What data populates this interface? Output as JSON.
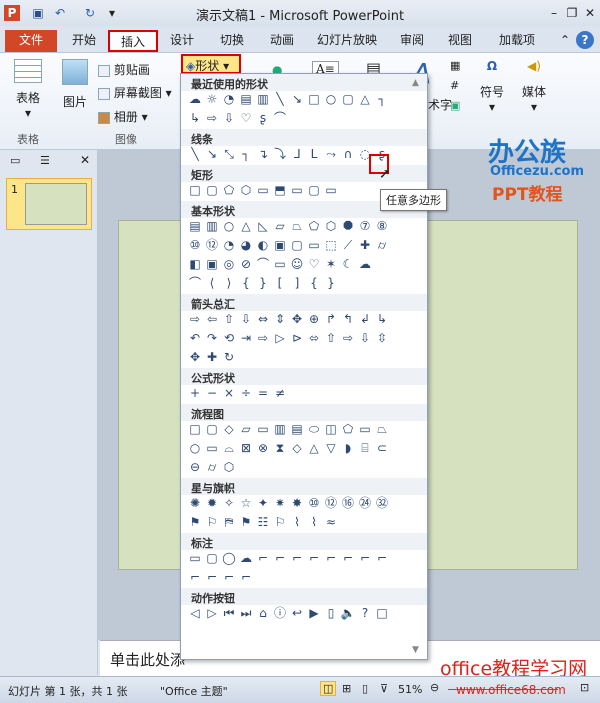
{
  "window": {
    "title": "演示文稿1  -  Microsoft PowerPoint"
  },
  "tabs": [
    "文件",
    "开始",
    "插入",
    "设计",
    "切换",
    "动画",
    "幻灯片放映",
    "审阅",
    "视图",
    "加载项"
  ],
  "ribbon": {
    "table": "表格",
    "table_group": "表格",
    "picture": "图片",
    "clipart": "剪贴画",
    "screenshot": "屏幕截图",
    "album": "相册",
    "image_group": "图像",
    "shapes": "形状",
    "wordart_partial": "术字",
    "symbol": "符号",
    "media": "媒体"
  },
  "gallery": {
    "categories": [
      {
        "name": "最近使用的形状",
        "rows": [
          [
            "☁",
            "☼",
            "◔",
            "▤",
            "▥",
            "╲",
            "↘",
            "□",
            "○",
            "▢",
            "△",
            "┐"
          ],
          [
            "↳",
            "⇨",
            "⇩",
            "♡",
            "ʂ",
            "⌒"
          ]
        ]
      },
      {
        "name": "线条",
        "rows": [
          [
            "╲",
            "↘",
            "⤡",
            "┐",
            "↴",
            "⤵",
            "ᒧ",
            "ᒪ",
            "⤳",
            "∩",
            "◌",
            "ʂ"
          ]
        ]
      },
      {
        "name": "矩形",
        "rows": [
          [
            "□",
            "▢",
            "⬠",
            "⬡",
            "▭",
            "⬒",
            "▭",
            "▢",
            "▭"
          ]
        ]
      },
      {
        "name": "基本形状",
        "rows": [
          [
            "▤",
            "▥",
            "○",
            "△",
            "◺",
            "▱",
            "⏢",
            "⬠",
            "⬡",
            "⯃",
            "⑦",
            "⑧"
          ],
          [
            "⑩",
            "⑫",
            "◔",
            "◕",
            "◐",
            "▣",
            "▢",
            "▭",
            "⬚",
            "⟋",
            "✚",
            "⌭"
          ],
          [
            "◧",
            "▣",
            "◎",
            "⊘",
            "⌒",
            "▭",
            "☺",
            "♡",
            "✶",
            "☾",
            "☁"
          ],
          [
            "⌒",
            "⟨",
            "⟩",
            "{",
            "}",
            "[",
            "]",
            "{",
            "}"
          ]
        ]
      },
      {
        "name": "箭头总汇",
        "rows": [
          [
            "⇨",
            "⇦",
            "⇧",
            "⇩",
            "⇔",
            "⇕",
            "✥",
            "⊕",
            "↱",
            "↰",
            "↲",
            "↳"
          ],
          [
            "↶",
            "↷",
            "⟲",
            "⇥",
            "⇨",
            "▷",
            "⊳",
            "⬄",
            "⇧",
            "⇨",
            "⇩",
            "⇳"
          ],
          [
            "✥",
            "✚",
            "↻"
          ]
        ]
      },
      {
        "name": "公式形状",
        "rows": [
          [
            "+",
            "−",
            "×",
            "÷",
            "=",
            "≠"
          ]
        ]
      },
      {
        "name": "流程图",
        "rows": [
          [
            "□",
            "▢",
            "◇",
            "▱",
            "▭",
            "▥",
            "▤",
            "⬭",
            "◫",
            "⬠",
            "▭",
            "⏢"
          ],
          [
            "○",
            "▭",
            "⌓",
            "⊠",
            "⊗",
            "⧗",
            "◇",
            "△",
            "▽",
            "◗",
            "⌸",
            "⊂"
          ],
          [
            "⊖",
            "⌭",
            "⬡"
          ]
        ]
      },
      {
        "name": "星与旗帜",
        "rows": [
          [
            "✺",
            "✹",
            "✧",
            "☆",
            "✦",
            "✷",
            "✸",
            "⑩",
            "⑫",
            "⑯",
            "㉔",
            "㉜"
          ],
          [
            "⚑",
            "⚐",
            "⛿",
            "⚑",
            "☷",
            "⚐",
            "⌇",
            "⌇",
            "≈"
          ]
        ]
      },
      {
        "name": "标注",
        "rows": [
          [
            "▭",
            "▢",
            "◯",
            "☁",
            "⌐",
            "⌐",
            "⌐",
            "⌐",
            "⌐",
            "⌐",
            "⌐",
            "⌐"
          ],
          [
            "⌐",
            "⌐",
            "⌐",
            "⌐"
          ]
        ]
      },
      {
        "name": "动作按钮",
        "rows": [
          [
            "◁",
            "▷",
            "⏮",
            "⏭",
            "⌂",
            "ⓘ",
            "↩",
            "▶",
            "▯",
            "🔈",
            "?",
            "□"
          ]
        ]
      }
    ]
  },
  "tooltip": "任意多边形",
  "watermark": {
    "brand": "办公族",
    "site": "Officezu.com",
    "sub": "PPT教程",
    "bottom": "office教程学习网",
    "url": "www.office68.com"
  },
  "slides_panel": {
    "slide_number": "1"
  },
  "notes": {
    "placeholder": "单击此处添"
  },
  "status": {
    "slide": "幻灯片 第 1 张，共 1 张",
    "theme": "\"Office 主题\"",
    "zoom": "51%"
  }
}
